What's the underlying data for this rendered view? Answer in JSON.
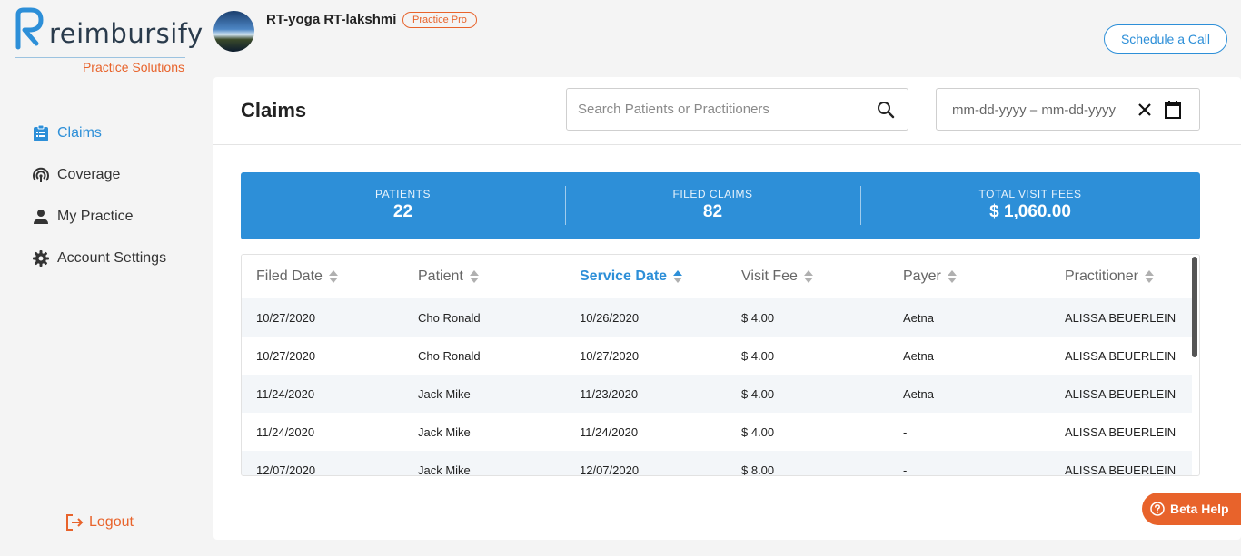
{
  "brand": {
    "name": "reimbursify",
    "tagline": "Practice Solutions",
    "accent": "#2d8fd8",
    "orange": "#e8632b"
  },
  "user": {
    "name": "RT-yoga RT-lakshmi",
    "badge": "Practice Pro"
  },
  "header": {
    "schedule_label": "Schedule a Call"
  },
  "sidebar": {
    "items": [
      {
        "label": "Claims",
        "icon": "clipboard-icon",
        "active": true
      },
      {
        "label": "Coverage",
        "icon": "coverage-icon",
        "active": false
      },
      {
        "label": "My Practice",
        "icon": "person-icon",
        "active": false
      },
      {
        "label": "Account Settings",
        "icon": "gear-icon",
        "active": false
      }
    ],
    "logout_label": "Logout"
  },
  "main": {
    "title": "Claims",
    "search": {
      "placeholder": "Search Patients or Practitioners",
      "value": ""
    },
    "date_range": {
      "placeholder": "mm-dd-yyyy – mm-dd-yyyy"
    }
  },
  "stats": [
    {
      "label": "PATIENTS",
      "value": "22"
    },
    {
      "label": "FILED CLAIMS",
      "value": "82"
    },
    {
      "label": "TOTAL VISIT FEES",
      "value": "$ 1,060.00"
    }
  ],
  "table": {
    "columns": [
      "Filed Date",
      "Patient",
      "Service Date",
      "Visit Fee",
      "Payer",
      "Practitioner"
    ],
    "sorted_column": "Service Date",
    "sort_direction": "ascending",
    "rows": [
      [
        "10/27/2020",
        "Cho Ronald",
        "10/26/2020",
        "$ 4.00",
        "Aetna",
        "ALISSA BEUERLEIN"
      ],
      [
        "10/27/2020",
        "Cho Ronald",
        "10/27/2020",
        "$ 4.00",
        "Aetna",
        "ALISSA BEUERLEIN"
      ],
      [
        "11/24/2020",
        "Jack Mike",
        "11/23/2020",
        "$ 4.00",
        "Aetna",
        "ALISSA BEUERLEIN"
      ],
      [
        "11/24/2020",
        "Jack Mike",
        "11/24/2020",
        "$ 4.00",
        "-",
        "ALISSA BEUERLEIN"
      ],
      [
        "12/07/2020",
        "Jack Mike",
        "12/07/2020",
        "$ 8.00",
        "-",
        "ALISSA BEUERLEIN"
      ]
    ]
  },
  "help": {
    "label": "Beta Help"
  }
}
